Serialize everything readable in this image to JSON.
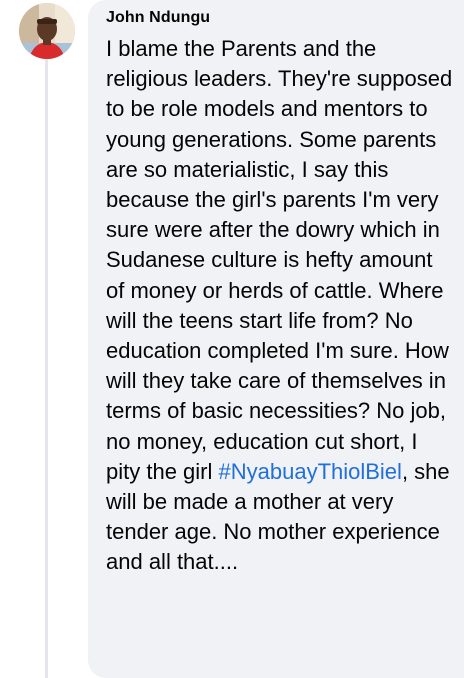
{
  "comment": {
    "author": "John Ndungu",
    "text_before_hashtag": "I blame the Parents and the religious leaders. They're supposed to be role models and mentors to young generations. Some parents are so materialistic, I say this because the girl's parents I'm very sure were after the dowry which in Sudanese culture is hefty amount of money or herds of cattle. Where will the teens start life from? No education completed I'm sure. How will they take care of themselves in terms of basic necessities? No job, no money, education cut short, I pity the girl ",
    "hashtag": "#NyabuayThiolBiel",
    "text_after_hashtag": ", she will be made a mother at very tender age. No mother experience and all that...."
  },
  "colors": {
    "bubble_background": "#f0f2f5",
    "hashtag_link": "#216fdb",
    "thread_line": "#e4e6eb"
  }
}
